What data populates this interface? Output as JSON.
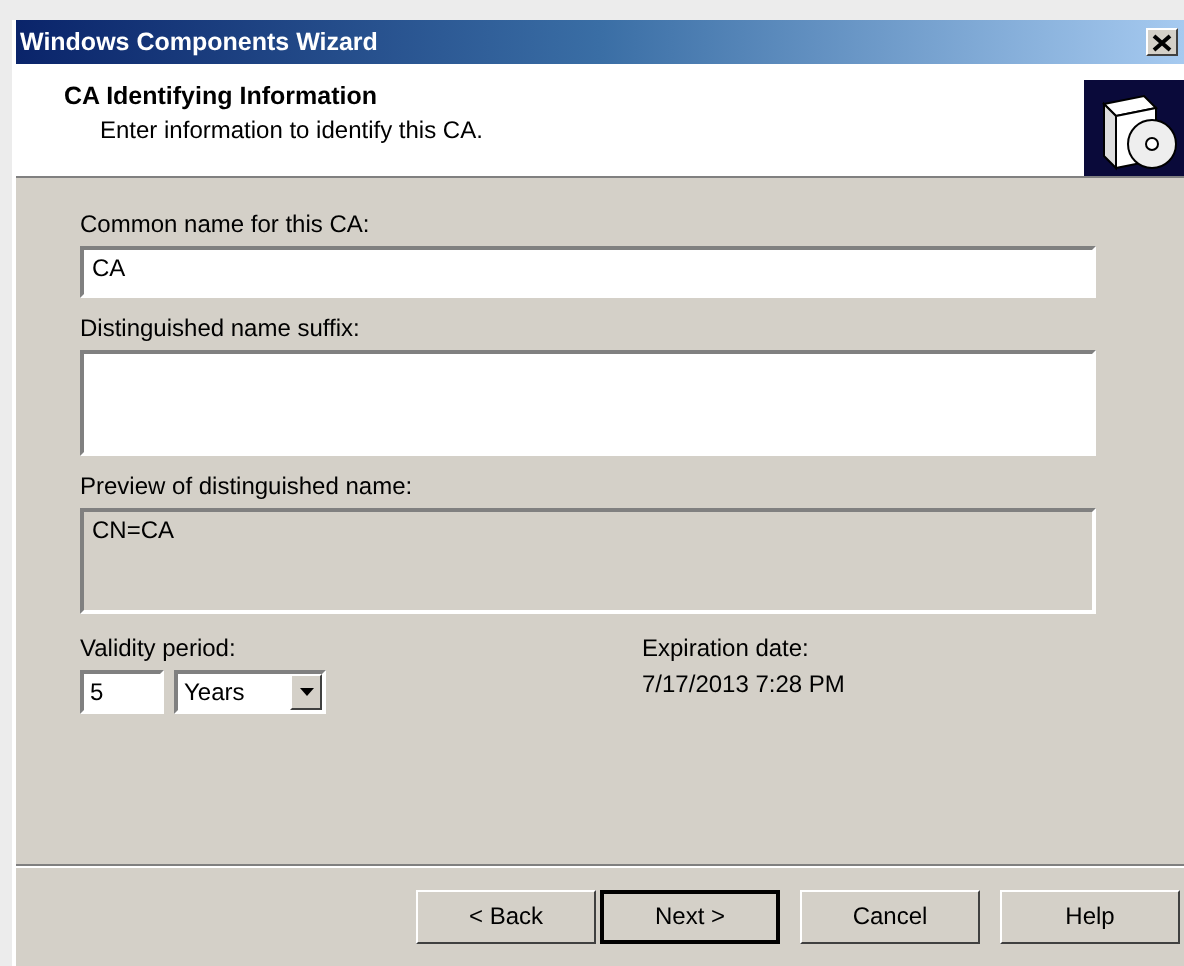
{
  "window": {
    "title": "Windows Components Wizard"
  },
  "header": {
    "title": "CA Identifying Information",
    "subtitle": "Enter information to identify this CA."
  },
  "fields": [
    {
      "kind": "text",
      "label": "Common name for this CA:",
      "value": "CA",
      "disabled": false
    },
    {
      "kind": "multiline",
      "label": "Distinguished name suffix:",
      "disabled": false
    },
    {
      "kind": "multiline",
      "label": "Preview of distinguished name:",
      "value": "CN=CA",
      "disabled": true
    }
  ],
  "validity": {
    "label": "Validity period:",
    "value": "5",
    "unit": "Years"
  },
  "expiration": {
    "label": "Expiration date:",
    "value": "7/17/2013 7:28 PM"
  },
  "buttons": [
    {
      "label": "< Back",
      "default": false
    },
    {
      "label": "Next >",
      "default": true
    },
    {
      "label": "Cancel",
      "default": false
    },
    {
      "label": "Help",
      "default": false
    }
  ]
}
